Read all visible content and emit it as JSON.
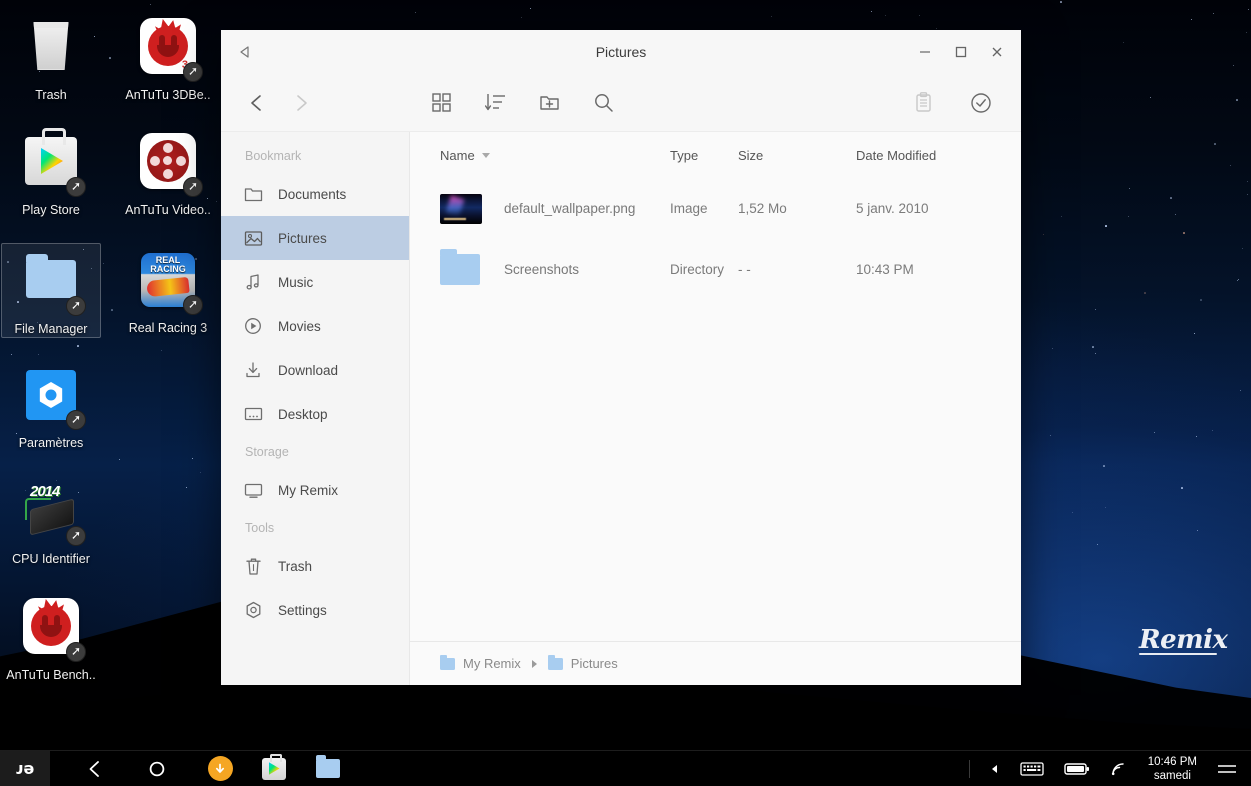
{
  "desktop": {
    "watermark": "Remix",
    "icons": [
      {
        "label": "Trash",
        "icon": "trash-icon",
        "shortcut": false,
        "selected": false,
        "badge": ""
      },
      {
        "label": "AnTuTu 3DBe..",
        "icon": "antutu-3dbench-icon",
        "shortcut": true,
        "selected": false,
        "badge": "3"
      },
      {
        "label": "Play Store",
        "icon": "play-store-icon",
        "shortcut": true,
        "selected": false,
        "badge": ""
      },
      {
        "label": "AnTuTu Video..",
        "icon": "antutu-video-icon",
        "shortcut": true,
        "selected": false,
        "badge": ""
      },
      {
        "label": "File Manager",
        "icon": "file-manager-icon",
        "shortcut": true,
        "selected": true,
        "badge": ""
      },
      {
        "label": "Real Racing 3",
        "icon": "real-racing-icon",
        "shortcut": true,
        "selected": false,
        "badge": "REAL RACING"
      },
      {
        "label": "Paramètres",
        "icon": "settings-icon",
        "shortcut": true,
        "selected": false,
        "badge": ""
      },
      {
        "label": "CPU Identifier",
        "icon": "cpu-identifier-icon",
        "shortcut": true,
        "selected": false,
        "badge": "2014"
      },
      {
        "label": "AnTuTu Bench..",
        "icon": "antutu-benchmark-icon",
        "shortcut": true,
        "selected": false,
        "badge": ""
      }
    ]
  },
  "window": {
    "title": "Pictures",
    "titlebar": {
      "back_icon": "back-triangle-icon",
      "minimize_icon": "minimize-icon",
      "maximize_icon": "maximize-icon",
      "close_icon": "close-icon"
    },
    "toolbar": {
      "nav_back_icon": "chevron-left-icon",
      "nav_forward_icon": "chevron-right-icon",
      "grid_view_icon": "grid-view-icon",
      "sort_icon": "sort-icon",
      "new_folder_icon": "new-folder-icon",
      "search_icon": "search-icon",
      "clipboard_icon": "clipboard-icon",
      "select_icon": "select-check-icon"
    },
    "sidebar": {
      "groups": [
        {
          "title": "Bookmark",
          "items": [
            {
              "label": "Documents",
              "icon": "folder-icon",
              "active": false
            },
            {
              "label": "Pictures",
              "icon": "image-icon",
              "active": true
            },
            {
              "label": "Music",
              "icon": "music-note-icon",
              "active": false
            },
            {
              "label": "Movies",
              "icon": "play-circle-icon",
              "active": false
            },
            {
              "label": "Download",
              "icon": "download-icon",
              "active": false
            },
            {
              "label": "Desktop",
              "icon": "desktop-icon",
              "active": false
            }
          ]
        },
        {
          "title": "Storage",
          "items": [
            {
              "label": "My Remix",
              "icon": "monitor-icon",
              "active": false
            }
          ]
        },
        {
          "title": "Tools",
          "items": [
            {
              "label": "Trash",
              "icon": "trash-icon",
              "active": false
            },
            {
              "label": "Settings",
              "icon": "settings-gear-icon",
              "active": false
            }
          ]
        }
      ]
    },
    "file_list": {
      "columns": [
        "Name",
        "Type",
        "Size",
        "Date Modified"
      ],
      "sort_column": "Name",
      "sort_direction": "descending",
      "rows": [
        {
          "name": "default_wallpaper.png",
          "type": "Image",
          "size": "1,52 Mo",
          "date": "5 janv. 2010",
          "icon": "image-thumbnail"
        },
        {
          "name": "Screenshots",
          "type": "Directory",
          "size": "- -",
          "date": "10:43 PM",
          "icon": "folder-thumbnail"
        }
      ]
    },
    "breadcrumb": [
      {
        "label": "My Remix",
        "icon": "folder-icon"
      },
      {
        "label": "Pictures",
        "icon": "folder-icon"
      }
    ]
  },
  "taskbar": {
    "logo": "remix-logo",
    "nav": [
      {
        "name": "back-button",
        "icon": "chevron-left-icon"
      },
      {
        "name": "home-button",
        "icon": "circle-icon"
      }
    ],
    "apps": [
      {
        "name": "downloads-app",
        "icon": "download-circle-icon"
      },
      {
        "name": "play-store-app",
        "icon": "play-store-icon"
      },
      {
        "name": "file-manager-app",
        "icon": "folder-icon"
      }
    ],
    "tray": [
      {
        "name": "tray-expand",
        "icon": "triangle-left-icon"
      },
      {
        "name": "keyboard-indicator",
        "icon": "keyboard-icon"
      },
      {
        "name": "battery-indicator",
        "icon": "battery-icon"
      },
      {
        "name": "wifi-indicator",
        "icon": "wifi-icon"
      }
    ],
    "clock": {
      "time": "10:46 PM",
      "day": "samedi"
    },
    "menu_icon": "hamburger-menu-icon"
  },
  "colors": {
    "window_bg": "#fafafa",
    "sidebar_bg": "#f5f5f5",
    "sidebar_active": "#bccde3",
    "folder_blue": "#a8cdf0",
    "accent_orange": "#f5a623",
    "taskbar_bg": "#000000"
  }
}
